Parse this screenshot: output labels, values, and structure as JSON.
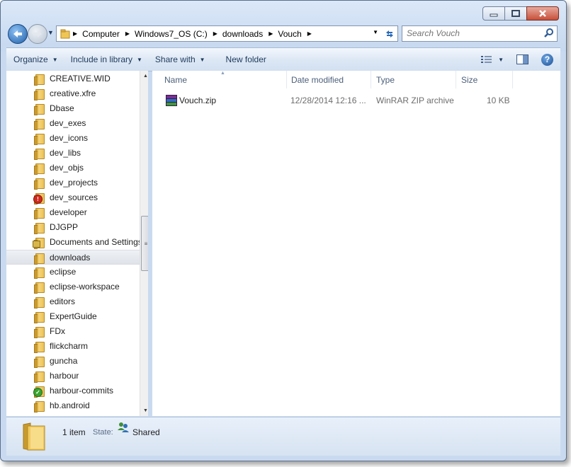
{
  "address": {
    "crumbs": [
      "Computer",
      "Windows7_OS (C:)",
      "downloads",
      "Vouch"
    ]
  },
  "search": {
    "placeholder": "Search Vouch"
  },
  "toolbar": {
    "organize": "Organize",
    "include_in_library": "Include in library",
    "share_with": "Share with",
    "new_folder": "New folder"
  },
  "tree": {
    "items": [
      {
        "label": "CREATIVE.WID",
        "icon": "folder-icon"
      },
      {
        "label": "creative.xfre",
        "icon": "folder-icon"
      },
      {
        "label": "Dbase",
        "icon": "folder-icon"
      },
      {
        "label": "dev_exes",
        "icon": "folder-icon"
      },
      {
        "label": "dev_icons",
        "icon": "folder-icon"
      },
      {
        "label": "dev_libs",
        "icon": "folder-icon"
      },
      {
        "label": "dev_objs",
        "icon": "folder-icon"
      },
      {
        "label": "dev_projects",
        "icon": "folder-icon"
      },
      {
        "label": "dev_sources",
        "icon": "error-badge-icon"
      },
      {
        "label": "developer",
        "icon": "folder-icon"
      },
      {
        "label": "DJGPP",
        "icon": "folder-icon"
      },
      {
        "label": "Documents and Settings",
        "icon": "locked-folder-icon"
      },
      {
        "label": "downloads",
        "icon": "folder-icon",
        "selected": true
      },
      {
        "label": "eclipse",
        "icon": "folder-icon"
      },
      {
        "label": "eclipse-workspace",
        "icon": "folder-icon"
      },
      {
        "label": "editors",
        "icon": "folder-icon"
      },
      {
        "label": "ExpertGuide",
        "icon": "folder-icon"
      },
      {
        "label": "FDx",
        "icon": "folder-icon"
      },
      {
        "label": "flickcharm",
        "icon": "folder-icon"
      },
      {
        "label": "guncha",
        "icon": "folder-icon"
      },
      {
        "label": "harbour",
        "icon": "folder-icon"
      },
      {
        "label": "harbour-commits",
        "icon": "ok-badge-icon"
      },
      {
        "label": "hb.android",
        "icon": "folder-icon"
      }
    ]
  },
  "columns": {
    "name": "Name",
    "date_modified": "Date modified",
    "type": "Type",
    "size": "Size"
  },
  "files": [
    {
      "name": "Vouch.zip",
      "date_modified": "12/28/2014 12:16 ...",
      "type": "WinRAR ZIP archive",
      "size": "10 KB",
      "icon": "winrar-zip-icon"
    }
  ],
  "status": {
    "count": "1 item",
    "state_label": "State:",
    "state_value": "Shared"
  },
  "colors": {
    "frame": "#c9daf0",
    "toolbar_text": "#1e395b",
    "selected_item": "#dfe3e9",
    "close_button": "#c7503a"
  }
}
